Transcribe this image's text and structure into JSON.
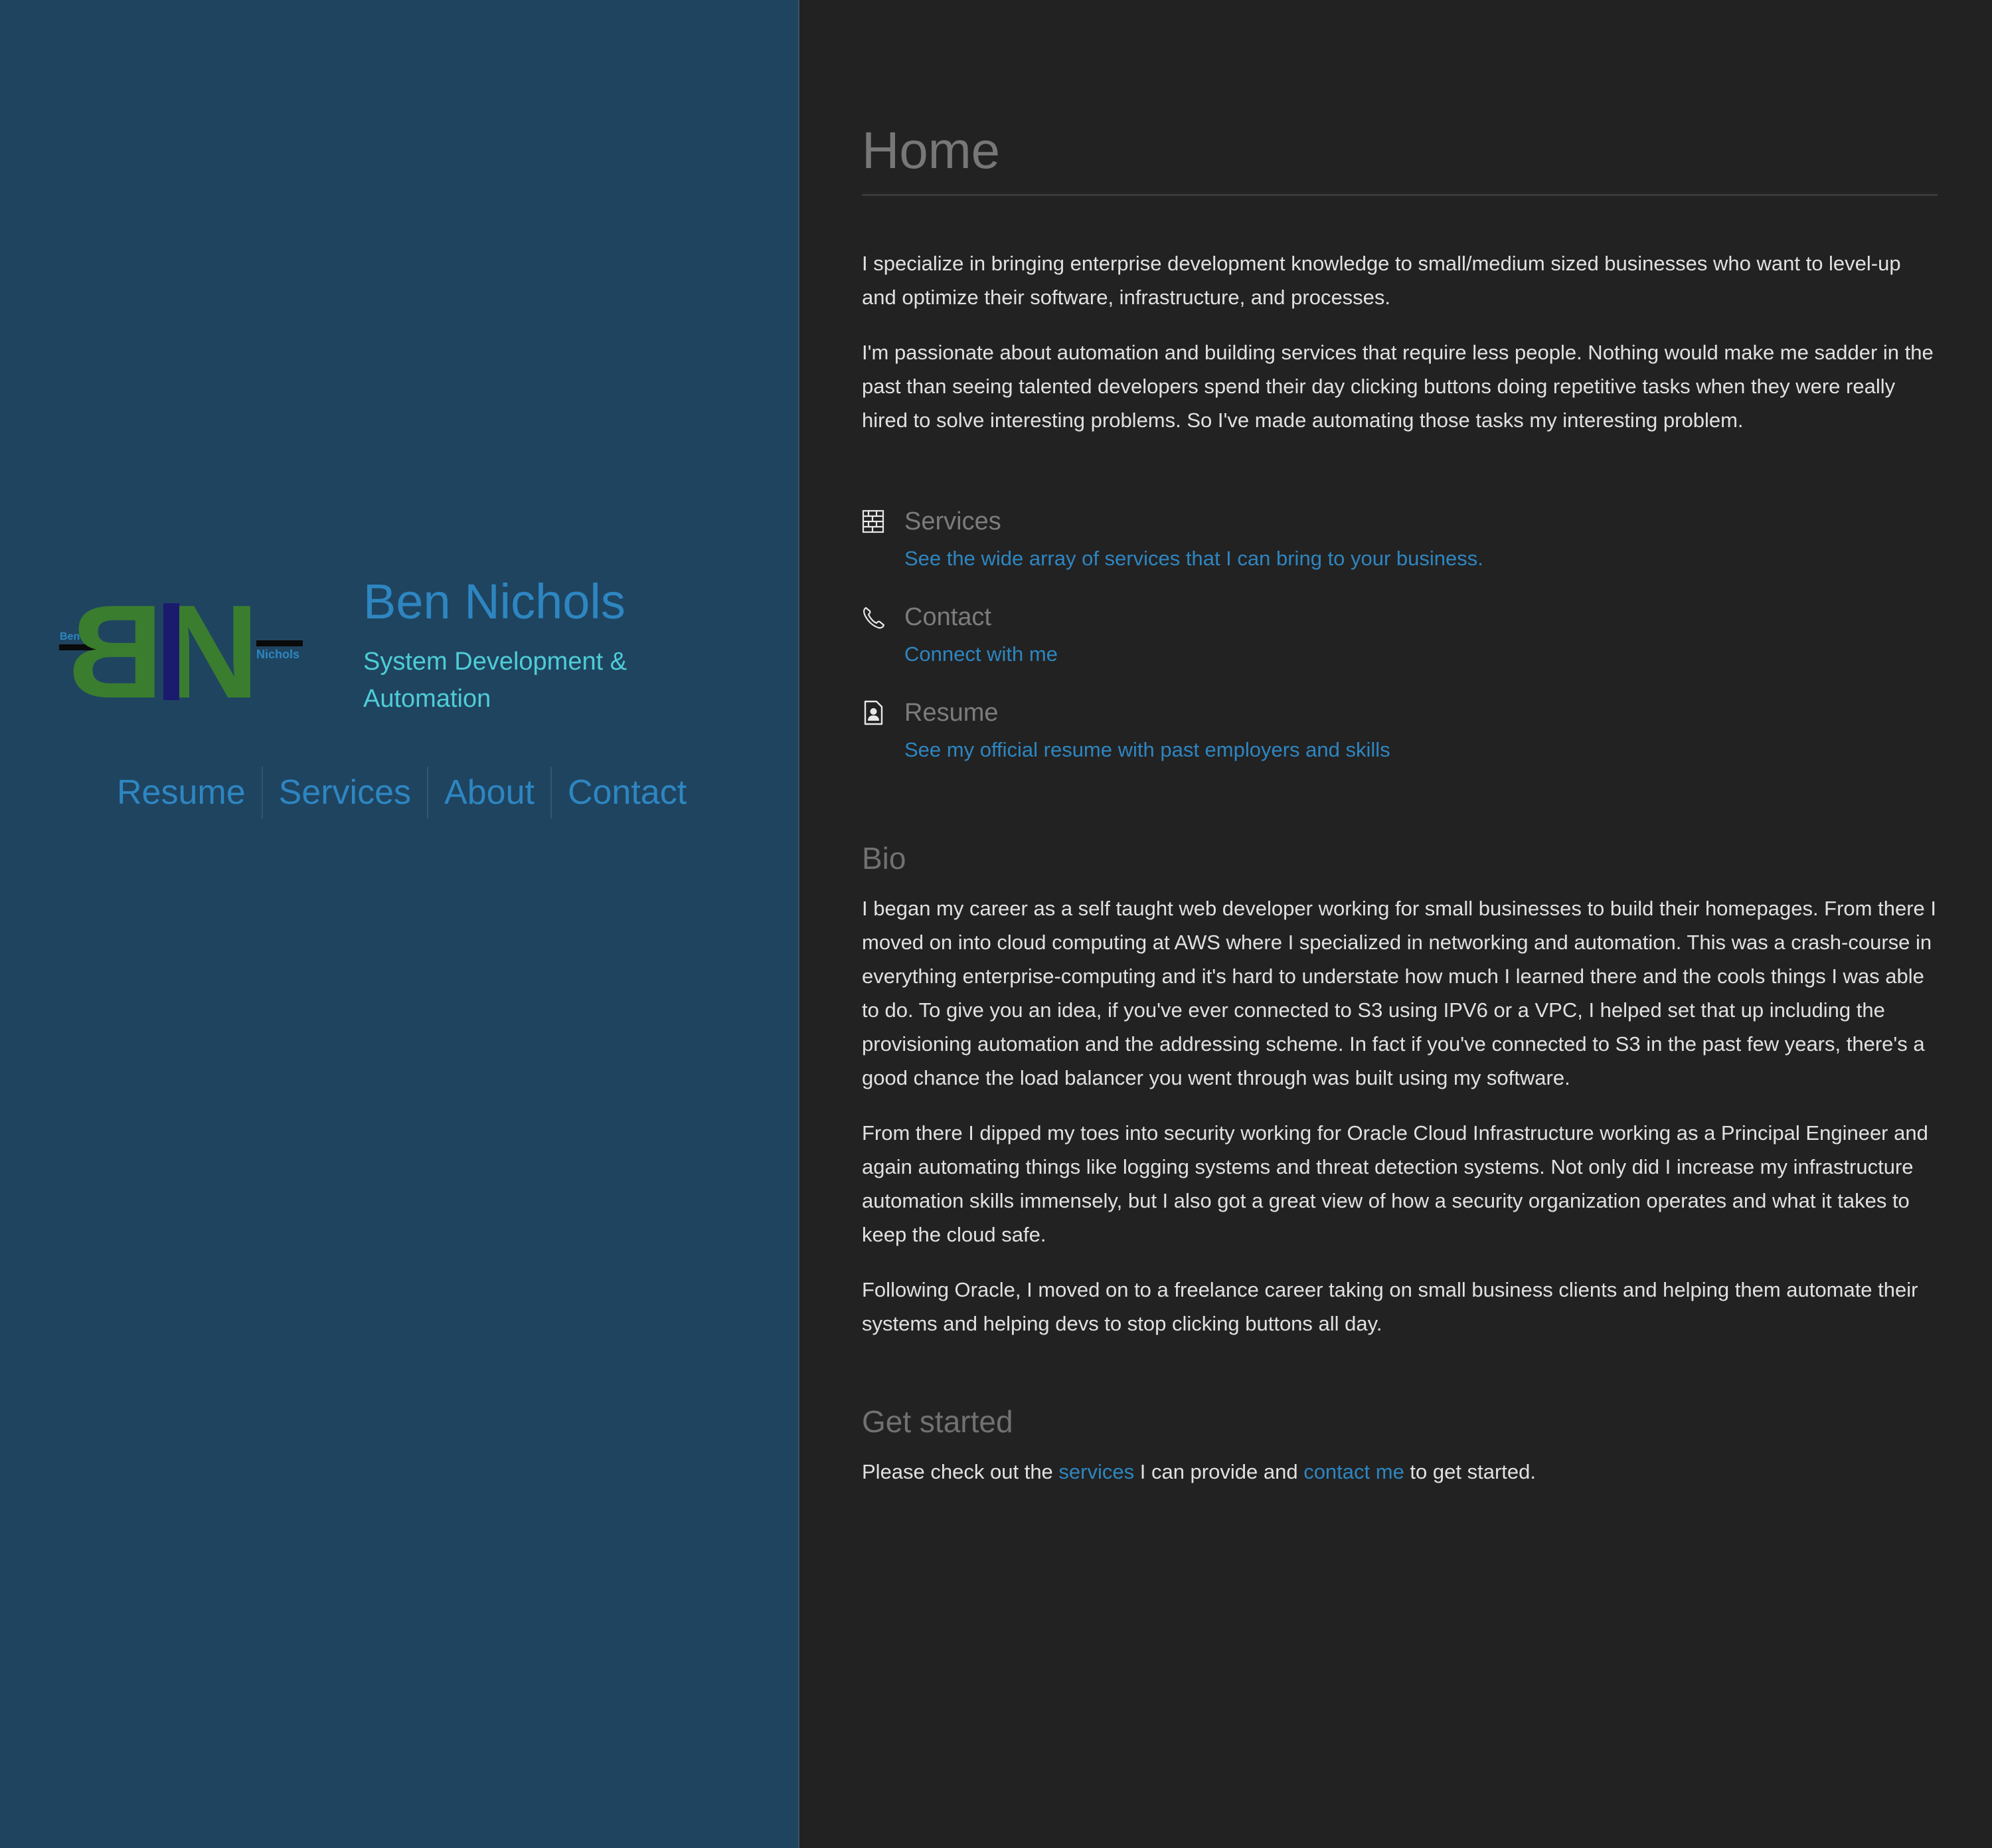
{
  "sidebar": {
    "logo": {
      "small_left": "Ben",
      "small_right": "Nichols",
      "letters_left": "B",
      "letters_right": "N",
      "colors": {
        "letters": "#3a7d2f",
        "bar": "#1b1b6e",
        "dash": "#0a0a0a",
        "small_text": "#2e86c1"
      }
    },
    "name": "Ben Nichols",
    "tagline": "System Development & Automation",
    "nav": [
      {
        "label": "Resume"
      },
      {
        "label": "Services"
      },
      {
        "label": "About"
      },
      {
        "label": "Contact"
      }
    ]
  },
  "main": {
    "title": "Home",
    "intro": [
      "I specialize in bringing enterprise development knowledge to small/medium sized businesses who want to level-up and optimize their software, infrastructure, and processes.",
      "I'm passionate about automation and building services that require less people. Nothing would make me sadder in the past than seeing talented developers spend their day clicking buttons doing repetitive tasks when they were really hired to solve interesting problems. So I've made automating those tasks my interesting problem."
    ],
    "links": [
      {
        "icon": "building-icon",
        "title": "Services",
        "description": "See the wide array of services that I can bring to your business."
      },
      {
        "icon": "phone-icon",
        "title": "Contact",
        "description": "Connect with me"
      },
      {
        "icon": "resume-icon",
        "title": "Resume",
        "description": "See my official resume with past employers and skills"
      }
    ],
    "bio": {
      "heading": "Bio",
      "paragraphs": [
        "I began my career as a self taught web developer working for small businesses to build their homepages. From there I moved on into cloud computing at AWS where I specialized in networking and automation. This was a crash-course in everything enterprise-computing and it's hard to understate how much I learned there and the cools things I was able to do. To give you an idea, if you've ever connected to S3 using IPV6 or a VPC, I helped set that up including the provisioning automation and the addressing scheme. In fact if you've connected to S3 in the past few years, there's a good chance the load balancer you went through was built using my software.",
        "From there I dipped my toes into security working for Oracle Cloud Infrastructure working as a Principal Engineer and again automating things like logging systems and threat detection systems. Not only did I increase my infrastructure automation skills immensely, but I also got a great view of how a security organization operates and what it takes to keep the cloud safe.",
        "Following Oracle, I moved on to a freelance career taking on small business clients and helping them automate their systems and helping devs to stop clicking buttons all day."
      ]
    },
    "get_started": {
      "heading": "Get started",
      "text_before": "Please check out the ",
      "link1": "services",
      "text_middle": " I can provide and ",
      "link2": "contact me",
      "text_after": " to get started."
    }
  },
  "colors": {
    "sidebar_bg": "#1f4460",
    "main_bg": "#222222",
    "link": "#2e86c1",
    "tagline": "#4ecdd6",
    "heading_gray": "#777777",
    "body_text": "#e1e1e1"
  }
}
